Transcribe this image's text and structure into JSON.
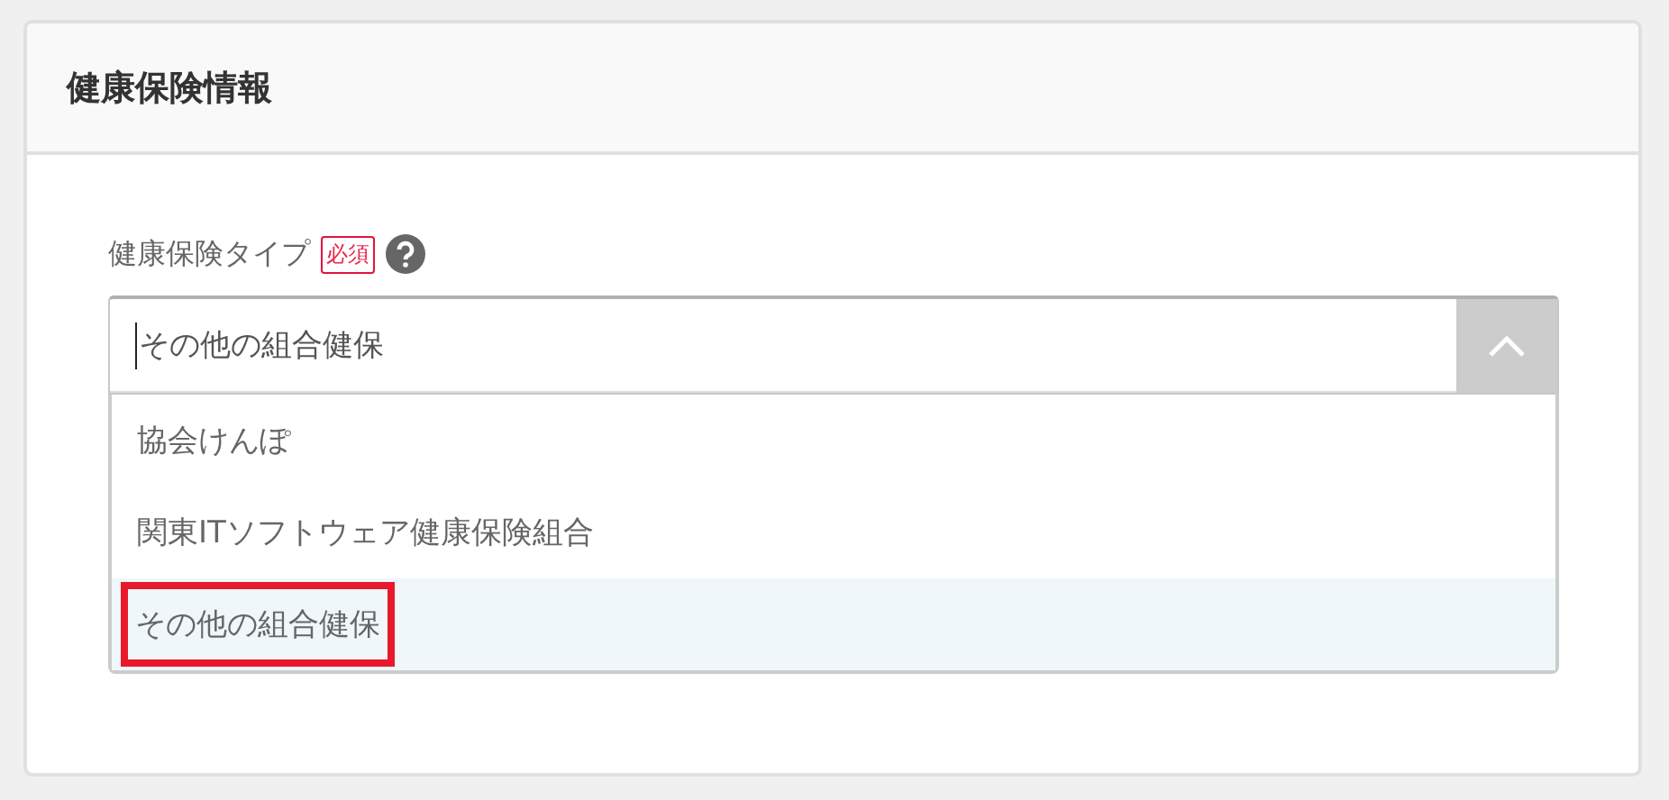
{
  "panel": {
    "title": "健康保険情報"
  },
  "field": {
    "label": "健康保険タイプ",
    "required_badge": "必須",
    "help": true,
    "value": "その他の組合健保",
    "expanded": true,
    "options": [
      {
        "label": "協会けんぽ",
        "selected": false,
        "outlined": false
      },
      {
        "label": "関東ITソフトウェア健康保険組合",
        "selected": false,
        "outlined": false
      },
      {
        "label": "その他の組合健保",
        "selected": true,
        "outlined": true
      }
    ]
  }
}
